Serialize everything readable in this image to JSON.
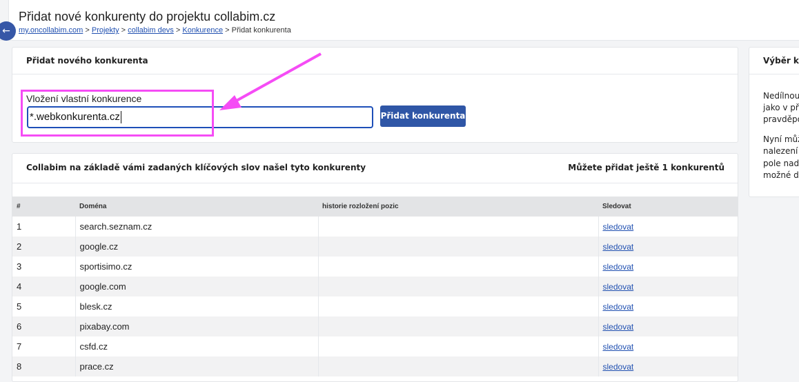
{
  "header": {
    "title": "Přidat nové konkurenty do projektu collabim.cz",
    "breadcrumbs": [
      {
        "label": "my.oncollabim.com"
      },
      {
        "label": "Projekty"
      },
      {
        "label": "collabim devs"
      },
      {
        "label": "Konkurence"
      },
      {
        "label": "Přidat konkurenta"
      }
    ]
  },
  "add_card": {
    "title": "Přidat nového konkurenta",
    "field_label": "Vložení vlastní konkurence",
    "field_value": "*.webkonkurenta.cz",
    "button_label": "Přidat konkurenta"
  },
  "competitors_card": {
    "title": "Collabim na základě vámi zadaných klíčových slov našel tyto konkurenty",
    "remaining_text": "Můžete přidat ještě 1 konkurentů",
    "columns": [
      "#",
      "Doména",
      "historie rozložení pozic",
      "Sledovat"
    ],
    "rows": [
      {
        "n": "1",
        "domain": "search.seznam.cz",
        "action": "sledovat"
      },
      {
        "n": "2",
        "domain": "google.cz",
        "action": "sledovat"
      },
      {
        "n": "3",
        "domain": "sportisimo.cz",
        "action": "sledovat"
      },
      {
        "n": "4",
        "domain": "google.com",
        "action": "sledovat"
      },
      {
        "n": "5",
        "domain": "blesk.cz",
        "action": "sledovat"
      },
      {
        "n": "6",
        "domain": "pixabay.com",
        "action": "sledovat"
      },
      {
        "n": "7",
        "domain": "csfd.cz",
        "action": "sledovat"
      },
      {
        "n": "8",
        "domain": "prace.cz",
        "action": "sledovat"
      }
    ]
  },
  "side_card": {
    "title": "Výběr ko",
    "para1": [
      "Nedílnou",
      "jako v pře",
      "pravděpo"
    ],
    "para2": [
      "Nyní můž",
      "nalezení",
      "pole nad",
      "možné do"
    ]
  },
  "colors": {
    "accent": "#2f56a6",
    "highlight": "#f54cf5"
  }
}
